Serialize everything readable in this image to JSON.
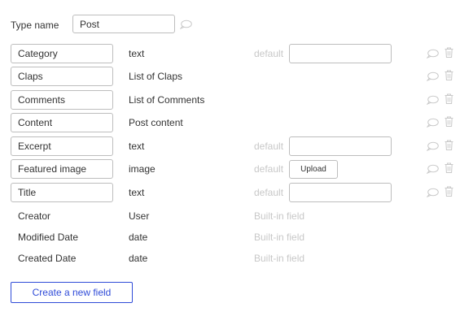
{
  "type_name": {
    "label": "Type name",
    "value": "Post",
    "icon": "comment-icon"
  },
  "fields": [
    {
      "name": "Category",
      "type": "text",
      "default_label": "default",
      "default_value": "",
      "control": "input"
    },
    {
      "name": "Claps",
      "type": "List of Claps",
      "control": "none"
    },
    {
      "name": "Comments",
      "type": "List of Comments",
      "control": "none"
    },
    {
      "name": "Content",
      "type": "Post content",
      "control": "none"
    },
    {
      "name": "Excerpt",
      "type": "text",
      "default_label": "default",
      "default_value": "",
      "control": "input"
    },
    {
      "name": "Featured image",
      "type": "image",
      "default_label": "default",
      "upload_label": "Upload",
      "control": "upload"
    },
    {
      "name": "Title",
      "type": "text",
      "default_label": "default",
      "default_value": "",
      "control": "input"
    }
  ],
  "builtin_fields": [
    {
      "name": "Creator",
      "type": "User",
      "note": "Built-in field"
    },
    {
      "name": "Modified Date",
      "type": "date",
      "note": "Built-in field"
    },
    {
      "name": "Created Date",
      "type": "date",
      "note": "Built-in field"
    }
  ],
  "row_icons": [
    "comment-icon",
    "trash-icon"
  ],
  "create_button_label": "Create a new field",
  "colors": {
    "accent": "#2f4bd8",
    "muted_text": "#c8c8c8",
    "border": "#bdbdbd",
    "icon": "#c9c9c9"
  }
}
